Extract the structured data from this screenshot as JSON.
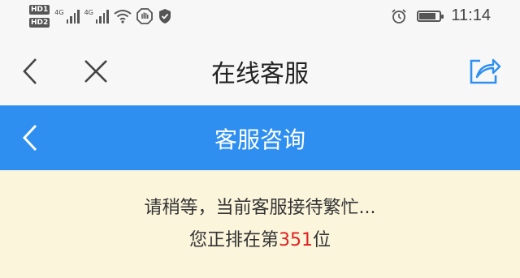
{
  "status_bar": {
    "sim1_label": "HD",
    "sim1_index": "1",
    "sim2_label": "HD",
    "sim2_index": "2",
    "network_label_1": "4G",
    "network_label_2": "4G",
    "icons": [
      "wifi-icon",
      "hand-icon",
      "shield-icon",
      "alarm-icon",
      "battery-icon"
    ],
    "battery_level": 0.85,
    "time": "11:14"
  },
  "nav": {
    "title": "在线客服",
    "icons": [
      "back-icon",
      "close-icon",
      "share-icon"
    ],
    "share_icon_color": "#2e8ff1"
  },
  "sub_header": {
    "title": "客服咨询",
    "background": "#2e8ff1"
  },
  "queue_notice": {
    "line1": "请稍等，当前客服接待繁忙...",
    "line2_prefix": "您正排在第",
    "position": "351",
    "line2_suffix": "位",
    "position_color": "#e02020",
    "background": "#fbf5dc"
  }
}
